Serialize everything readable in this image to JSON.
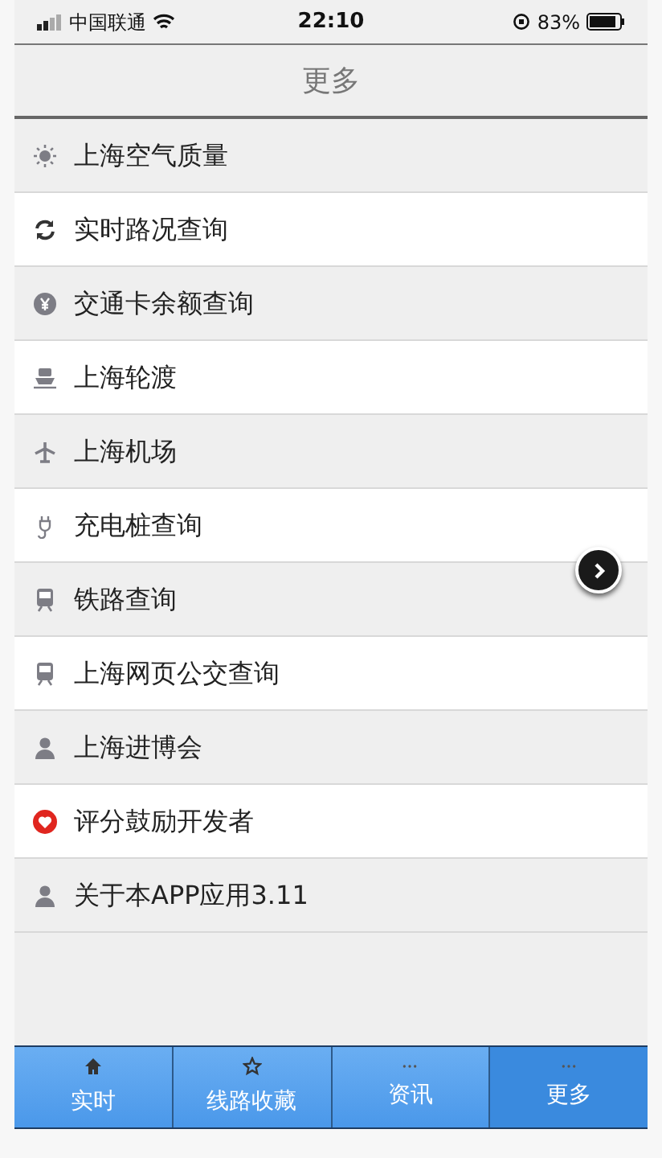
{
  "status_bar": {
    "carrier": "中国联通",
    "time": "22:10",
    "battery": "83%"
  },
  "nav_bar": {
    "title": "更多"
  },
  "menu": {
    "items": [
      {
        "label": "上海空气质量"
      },
      {
        "label": "实时路况查询"
      },
      {
        "label": "交通卡余额查询"
      },
      {
        "label": "上海轮渡"
      },
      {
        "label": "上海机场"
      },
      {
        "label": "充电桩查询"
      },
      {
        "label": "铁路查询"
      },
      {
        "label": "上海网页公交查询"
      },
      {
        "label": "上海进博会"
      },
      {
        "label": "评分鼓励开发者"
      },
      {
        "label": "关于本APP应用3.11"
      }
    ]
  },
  "tab_bar": {
    "tabs": [
      {
        "label": "实时",
        "selected": false
      },
      {
        "label": "线路收藏",
        "selected": false
      },
      {
        "label": "资讯",
        "selected": false
      },
      {
        "label": "更多",
        "selected": true
      }
    ]
  }
}
